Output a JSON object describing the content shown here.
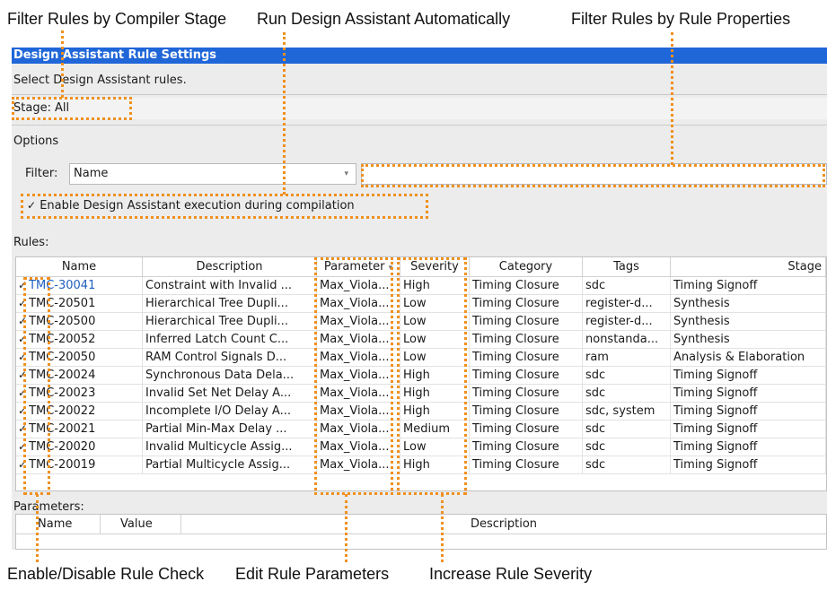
{
  "callouts": {
    "filter_stage": "Filter Rules by Compiler Stage",
    "run_auto": "Run Design Assistant Automatically",
    "filter_props": "Filter Rules by Rule Properties",
    "enable_disable": "Enable/Disable Rule Check",
    "edit_params": "Edit Rule Parameters",
    "increase_severity": "Increase Rule Severity"
  },
  "window": {
    "title": "Design Assistant Rule Settings"
  },
  "intro": "Select Design Assistant rules.",
  "stage": {
    "label": "Stage:",
    "value": "All"
  },
  "options": {
    "label": "Options",
    "filter_label": "Filter:",
    "filter_value": "Name",
    "filter_text": "",
    "enable_checkbox": "✓",
    "enable_label": "Enable Design Assistant execution during compilation"
  },
  "rules": {
    "label": "Rules:",
    "columns": [
      "Name",
      "Description",
      "Parameter",
      "Severity",
      "Category",
      "Tags",
      "Stage"
    ],
    "rows": [
      {
        "check": "✓",
        "name": "TMC-30041",
        "desc": "Constraint with Invalid ...",
        "param": "Max_Viola...",
        "severity": "High",
        "category": "Timing Closure",
        "tags": "sdc",
        "stage": "Timing Signoff"
      },
      {
        "check": "✓",
        "name": "TMC-20501",
        "desc": "Hierarchical Tree Dupli...",
        "param": "Max_Viola...",
        "severity": "Low",
        "category": "Timing Closure",
        "tags": "register-d...",
        "stage": "Synthesis"
      },
      {
        "check": "✓",
        "name": "TMC-20500",
        "desc": "Hierarchical Tree Dupli...",
        "param": "Max_Viola...",
        "severity": "Low",
        "category": "Timing Closure",
        "tags": "register-d...",
        "stage": "Synthesis"
      },
      {
        "check": "✓",
        "name": "TMC-20052",
        "desc": "Inferred Latch Count C...",
        "param": "Max_Viola...",
        "severity": "Low",
        "category": "Timing Closure",
        "tags": "nonstanda...",
        "stage": "Synthesis"
      },
      {
        "check": "✓",
        "name": "TMC-20050",
        "desc": "RAM Control Signals D...",
        "param": "Max_Viola...",
        "severity": "Low",
        "category": "Timing Closure",
        "tags": "ram",
        "stage": "Analysis & Elaboration"
      },
      {
        "check": "✓",
        "name": "TMC-20024",
        "desc": "Synchronous Data Dela...",
        "param": "Max_Viola...",
        "severity": "High",
        "category": "Timing Closure",
        "tags": "sdc",
        "stage": "Timing Signoff"
      },
      {
        "check": "✓",
        "name": "TMC-20023",
        "desc": "Invalid Set Net Delay A...",
        "param": "Max_Viola...",
        "severity": "High",
        "category": "Timing Closure",
        "tags": "sdc",
        "stage": "Timing Signoff"
      },
      {
        "check": "✓",
        "name": "TMC-20022",
        "desc": "Incomplete I/O Delay A...",
        "param": "Max_Viola...",
        "severity": "High",
        "category": "Timing Closure",
        "tags": "sdc, system",
        "stage": "Timing Signoff"
      },
      {
        "check": "✓",
        "name": "TMC-20021",
        "desc": "Partial Min-Max Delay ...",
        "param": "Max_Viola...",
        "severity": "Medium",
        "category": "Timing Closure",
        "tags": "sdc",
        "stage": "Timing Signoff"
      },
      {
        "check": "✓",
        "name": "TMC-20020",
        "desc": "Invalid Multicycle Assig...",
        "param": "Max_Viola...",
        "severity": "Low",
        "category": "Timing Closure",
        "tags": "sdc",
        "stage": "Timing Signoff"
      },
      {
        "check": "✓",
        "name": "TMC-20019",
        "desc": "Partial Multicycle Assig...",
        "param": "Max_Viola...",
        "severity": "High",
        "category": "Timing Closure",
        "tags": "sdc",
        "stage": "Timing Signoff"
      }
    ]
  },
  "parameters": {
    "label": "Parameters:",
    "columns": [
      "Name",
      "Value",
      "Description"
    ]
  },
  "colors": {
    "titlebar": "#1f66d8",
    "callout_outline": "#f0901e"
  }
}
